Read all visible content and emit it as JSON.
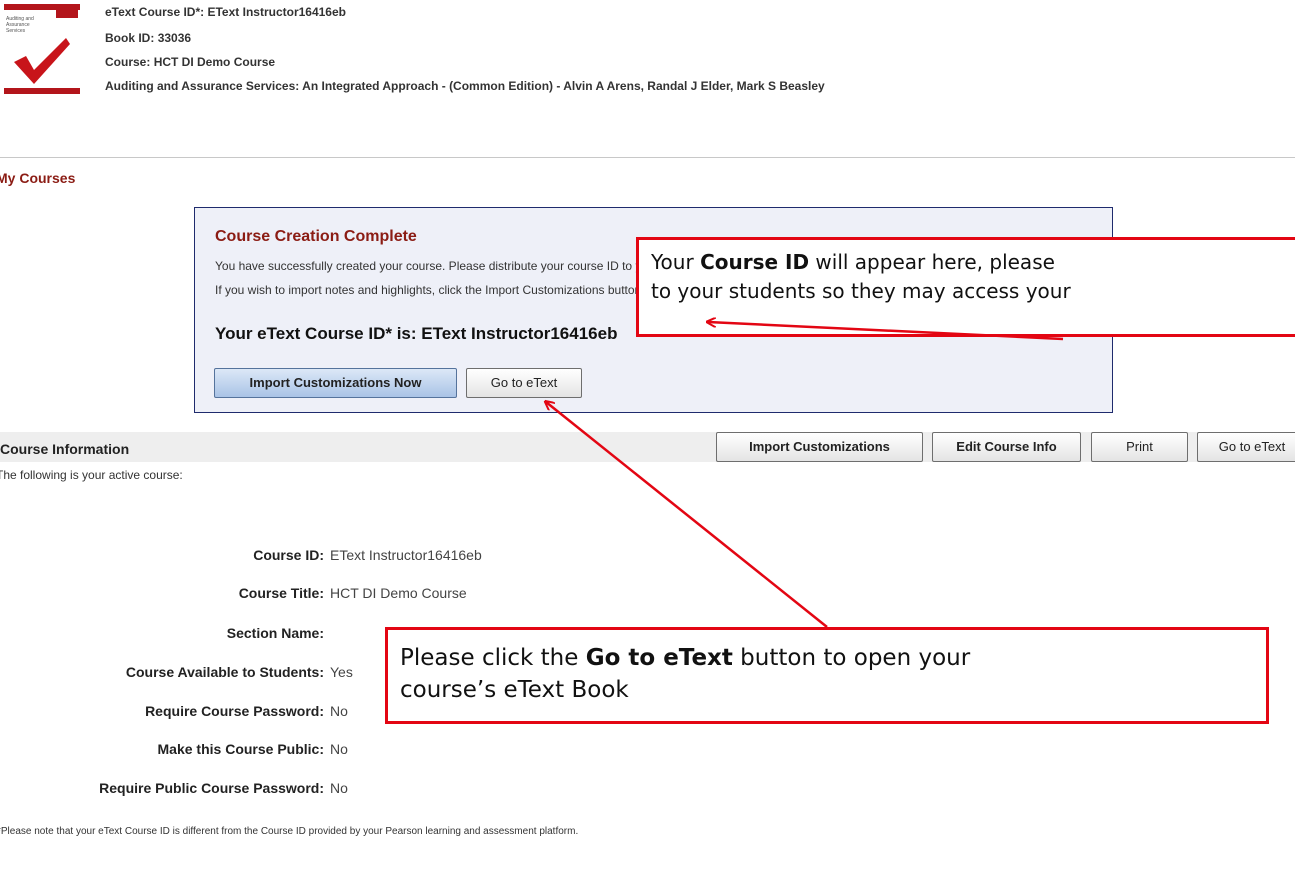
{
  "header": {
    "book_cover_title": "Auditing and Assurance Services",
    "etext_course_id_label": "eText Course ID*:",
    "etext_course_id_value": "EText Instructor16416eb",
    "book_id_label": "Book ID:",
    "book_id_value": "33036",
    "course_label": "Course:",
    "course_value": "HCT DI Demo Course",
    "book_full_title": "Auditing and Assurance Services: An Integrated Approach - (Common Edition) - Alvin A Arens, Randal J Elder, Mark S Beasley"
  },
  "my_courses": "My Courses",
  "creation_panel": {
    "title": "Course Creation Complete",
    "text_1": "You have successfully created your course. Please distribute your course ID to your students so that they can join your course.",
    "text_2": "If you wish to import notes and highlights, click the Import Customizations button.",
    "course_id_line": "Your eText Course ID* is: EText Instructor16416eb",
    "import_now_button": "Import Customizations Now",
    "go_to_etext_button": "Go to eText"
  },
  "course_info": {
    "title": "Course Information",
    "buttons": {
      "import": "Import Customizations",
      "edit": "Edit Course Info",
      "print": "Print",
      "go_to_etext": "Go to eText"
    },
    "active_text": "The following is your active course:",
    "details": [
      {
        "label": "Course ID:",
        "value": "EText Instructor16416eb"
      },
      {
        "label": "Course Title:",
        "value": "HCT DI Demo Course"
      },
      {
        "label": "Section Name:",
        "value": ""
      },
      {
        "label": "Course Available to Students:",
        "value": "Yes"
      },
      {
        "label": "Require Course Password:",
        "value": "No"
      },
      {
        "label": "Make this Course Public:",
        "value": "No"
      },
      {
        "label": "Require Public Course Password:",
        "value": "No"
      }
    ]
  },
  "footnote": "*Please note that your eText Course ID is different from the Course ID provided by your Pearson learning and assessment platform.",
  "callout_top": {
    "pre": "Your ",
    "bold": "Course ID",
    "post_1": " will appear here, please",
    "line_2": "to your students so they may access your"
  },
  "callout_bottom": {
    "pre": "Please click the ",
    "bold": "Go to eText",
    "post_1": " button to open your",
    "line_2": "course’s eText Book"
  },
  "colors": {
    "accent_red": "#e30613",
    "heading_maroon": "#8b1c14",
    "panel_border": "#1f2b6d",
    "panel_bg": "#eef0f8"
  }
}
